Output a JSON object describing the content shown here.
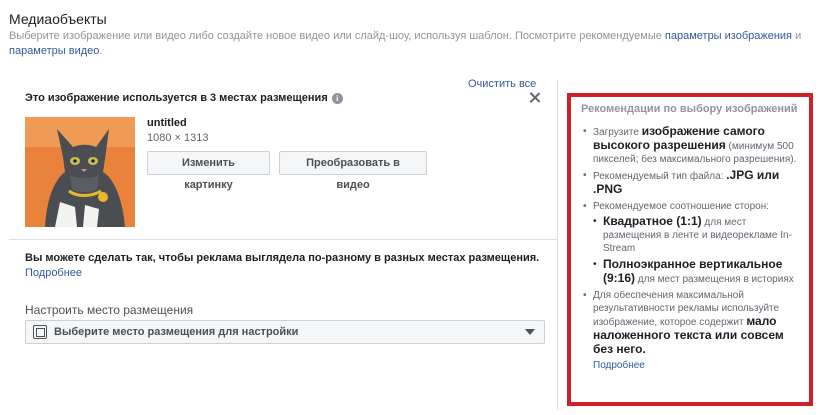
{
  "header": {
    "title": "Медиаобъекты",
    "subtitle_pre": "Выберите изображение или видео либо создайте новое видео или слайд-шоу, используя шаблон. Посмотрите рекомендуемые ",
    "link_image_params": "параметры изображения",
    "subtitle_and": " и ",
    "link_video_params": "параметры видео",
    "subtitle_end": "."
  },
  "media": {
    "clear_all": "Очистить все",
    "usage_text": "Это изображение используется в 3 местах размещения",
    "info_icon": "i",
    "file_name": "untitled",
    "file_dims": "1080 × 1313",
    "btn_change": "Изменить картинку",
    "btn_convert": "Преобразовать в видео"
  },
  "placement": {
    "diff_text": "Вы можете сделать так, чтобы реклама выглядела по-разному в разных местах размещения.",
    "learn_more": "Подробнее",
    "label": "Настроить место размещения",
    "select_value": "Выберите место размещения для настройки"
  },
  "recommendations": {
    "title": "Рекомендации по выбору изображений",
    "item1_pre": "Загрузите ",
    "item1_bold": "изображение самого высокого разрешения",
    "item1_post": " (минимум 500 пикселей; без максимального разрешения).",
    "item2_pre": "Рекомендуемый тип файла: ",
    "item2_bold": ".JPG или .PNG",
    "item3": "Рекомендуемое соотношение сторон:",
    "sub1_bold": "Квадратное (1:1)",
    "sub1_post": " для мест размещения в ленте и видеорекламе In-Stream",
    "sub2_bold": "Полноэкранное вертикальное (9:16)",
    "sub2_post": " для мест размещения в историях",
    "item4_pre": "Для обеспечения максимальной результативности рекламы используйте изображение, которое содержит ",
    "item4_bold": "мало наложенного текста или совсем без него.",
    "learn_more": "Подробнее"
  },
  "colors": {
    "accent_link": "#365899",
    "highlight_border": "#d0212a",
    "thumb_bg": "#e07a2a"
  }
}
